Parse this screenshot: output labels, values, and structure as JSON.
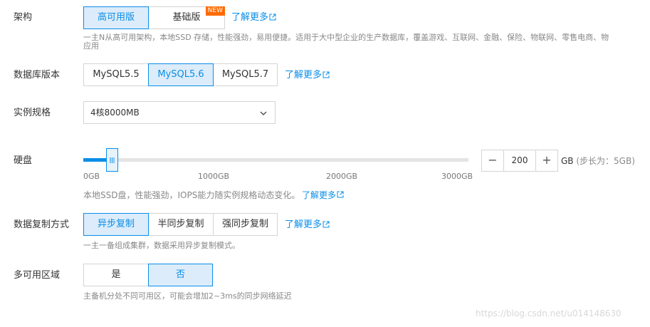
{
  "arch": {
    "label": "架构",
    "options": [
      "高可用版",
      "基础版"
    ],
    "selected": "高可用版",
    "badge": "NEW",
    "link": "了解更多",
    "note_line1": "一主N从高可用架构，本地SSD 存储，性能强劲，易用便捷。适用于大中型企业的生产数据库，覆盖游戏、互联网、金融、保险、物联网、零售电商、物",
    "note_line2": "应用"
  },
  "version": {
    "label": "数据库版本",
    "options": [
      "MySQL5.5",
      "MySQL5.6",
      "MySQL5.7"
    ],
    "selected": "MySQL5.6",
    "link": "了解更多"
  },
  "spec": {
    "label": "实例规格",
    "value": "4核8000MB",
    "icon": "chevron-down-icon"
  },
  "disk": {
    "label": "硬盘",
    "value": 200,
    "min": 0,
    "max": 3000,
    "ticks": [
      "0GB",
      "1000GB",
      "2000GB",
      "3000GB"
    ],
    "stepper_minus": "−",
    "stepper_plus": "+",
    "unit": "GB",
    "step_hint": "(步长为：5GB)",
    "note": "本地SSD盘，性能强劲，IOPS能力随实例规格动态变化。",
    "link": "了解更多"
  },
  "replication": {
    "label": "数据复制方式",
    "options": [
      "异步复制",
      "半同步复制",
      "强同步复制"
    ],
    "selected": "异步复制",
    "link": "了解更多",
    "note": "一主一备组成集群，数据采用异步复制模式。"
  },
  "multi_az": {
    "label": "多可用区域",
    "options": [
      "是",
      "否"
    ],
    "selected": "否",
    "note": "主备机分处不同可用区，可能会增加2~3ms的同步网络延迟"
  },
  "watermark": "https://blog.csdn.net/u014148630",
  "colors": {
    "accent": "#0a8ee8",
    "active_bg": "#dcecfa",
    "badge": "#ff6a00"
  }
}
